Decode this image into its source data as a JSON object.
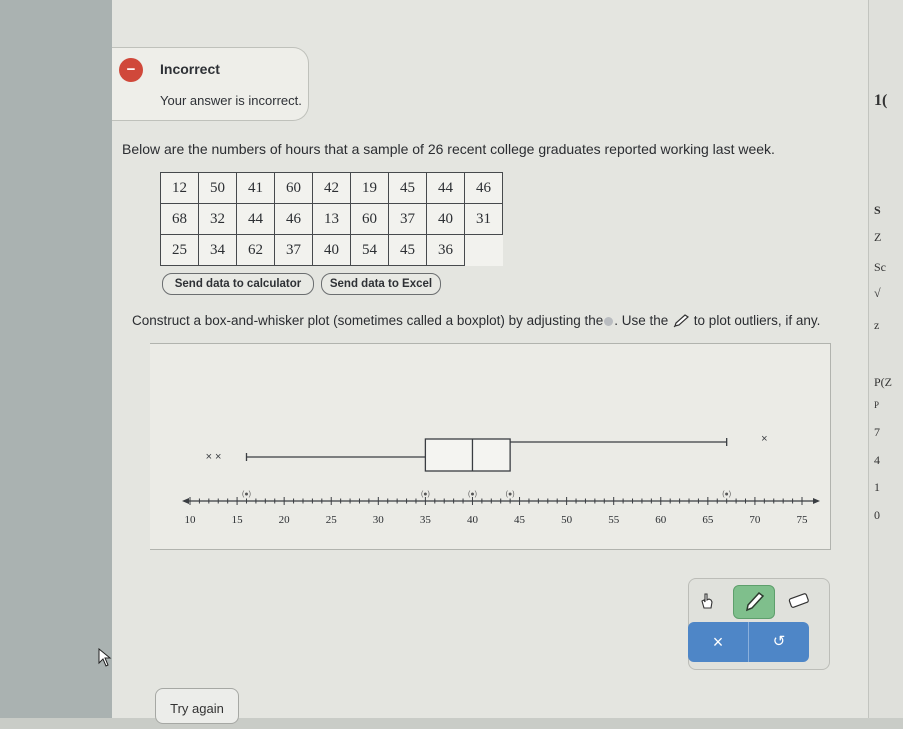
{
  "feedback": {
    "icon": "minus-circle-icon",
    "status": "Incorrect",
    "message": "Your answer is incorrect."
  },
  "question": {
    "prompt": "Below are the numbers of hours that a sample of 26 recent college graduates reported working last week.",
    "table": [
      [
        "12",
        "50",
        "41",
        "60",
        "42",
        "19",
        "45",
        "44",
        "46"
      ],
      [
        "68",
        "32",
        "44",
        "46",
        "13",
        "60",
        "37",
        "40",
        "31"
      ],
      [
        "25",
        "34",
        "62",
        "37",
        "40",
        "54",
        "45",
        "36",
        ""
      ]
    ],
    "send_calc_label": "Send data to calculator",
    "send_excel_label": "Send data to Excel",
    "instruction_part1": "Construct a box-and-whisker plot (sometimes called a boxplot) by adjusting the",
    "instruction_part2": ". Use the",
    "instruction_part3": "to plot outliers, if any."
  },
  "boxplot": {
    "axis": {
      "min": 10,
      "max": 75,
      "ticks": [
        10,
        15,
        20,
        25,
        30,
        35,
        40,
        45,
        50,
        55,
        60,
        65,
        70,
        75
      ],
      "minor_step": 1
    },
    "box": {
      "q1": 35,
      "median": 40,
      "q3": 44
    },
    "whiskers": {
      "low": 16,
      "high": 67
    },
    "outliers": [
      12,
      13,
      71
    ],
    "handle_glyph": "(●)",
    "handles_on_axis": [
      16,
      35,
      40,
      44,
      67
    ],
    "outlier_glyph": "×"
  },
  "tools": {
    "pointer_icon": "hand-pointer-icon",
    "pen_icon": "pencil-icon",
    "eraser_icon": "eraser-icon",
    "clear_label": "×",
    "undo_label": "↺"
  },
  "try_again_label": "Try again",
  "right_panel_fragments": [
    "1(",
    "S",
    "Z",
    "Sc",
    "√",
    "z",
    "P(Z",
    "P",
    "7",
    "4",
    "1",
    "0"
  ],
  "colors": {
    "incorrect": "#d0483a",
    "tool_active": "#7fbf8c",
    "action_button": "#4e86c7"
  }
}
